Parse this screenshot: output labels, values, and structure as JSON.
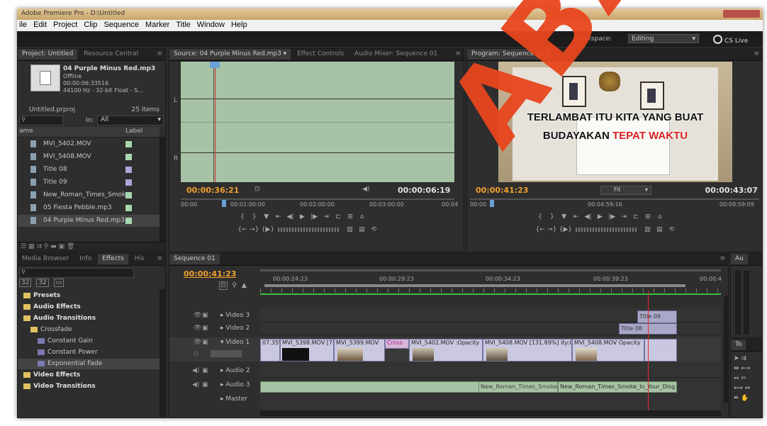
{
  "app": {
    "title": "Adobe Premiere Pro - D:\\Untitled"
  },
  "menu": [
    "ile",
    "Edit",
    "Project",
    "Clip",
    "Sequence",
    "Marker",
    "Title",
    "Window",
    "Help"
  ],
  "workspace": {
    "label": "Workspace:",
    "value": "Editing",
    "cs_live": "CS Live"
  },
  "project_panel": {
    "tabs": [
      "Project: Untitled",
      "Resource Central"
    ],
    "preview": {
      "name": "04 Purple Minus Red.mp3",
      "status": "Offline",
      "duration": "00:00:06:33516",
      "format": "44100 Hz - 32-bit Float - S..."
    },
    "project_file": "Untitled.prproj",
    "item_count": "25 Items",
    "in_label": "In:",
    "in_value": "All",
    "columns": {
      "name": "ame",
      "label": "Label"
    },
    "items": [
      {
        "name": "MVI_5402.MOV",
        "color": "#a8d8b0",
        "icon": "video-clip-icon"
      },
      {
        "name": "MVI_5408.MOV",
        "color": "#a8d8b0",
        "icon": "video-clip-icon"
      },
      {
        "name": "Title 08",
        "color": "#a9a8d8",
        "icon": "title-icon"
      },
      {
        "name": "Title 09",
        "color": "#a9a8d8",
        "icon": "title-icon"
      },
      {
        "name": "New_Roman_Times_Smok",
        "color": "#a8d8b0",
        "icon": "audio-clip-icon"
      },
      {
        "name": "05 Fiesta Pebble.mp3",
        "color": "#a8d8b0",
        "icon": "audio-file-icon"
      },
      {
        "name": "04 Purple Minus Red.mp3",
        "color": "#a8d8b0",
        "icon": "audio-file-icon"
      }
    ]
  },
  "effects_panel": {
    "tabs": [
      "Media Browser",
      "Info",
      "Effects",
      "His"
    ],
    "items": [
      {
        "label": "Presets",
        "level": 0
      },
      {
        "label": "Audio Effects",
        "level": 0
      },
      {
        "label": "Audio Transitions",
        "level": 0
      },
      {
        "label": "Crossfade",
        "level": 1
      },
      {
        "label": "Constant Gain",
        "level": 2
      },
      {
        "label": "Constant Power",
        "level": 2
      },
      {
        "label": "Exponential Fade",
        "level": 2
      },
      {
        "label": "Video Effects",
        "level": 0
      },
      {
        "label": "Video Transitions",
        "level": 0
      }
    ]
  },
  "source_monitor": {
    "tabs": [
      "Source: 04 Purple Minus Red.mp3",
      "Effect Controls",
      "Audio Mixer: Sequence 01"
    ],
    "channel_l": "L",
    "channel_r": "R",
    "timecode_current": "00:00:36:21",
    "timecode_duration": "00:00:06:19",
    "ruler": [
      "00:00",
      "00:01:00:00",
      "00:02:00:00",
      "00:03:00:00",
      "00:04"
    ]
  },
  "program_monitor": {
    "tabs": [
      "Program: Sequence 01"
    ],
    "overlay_line1": "TERLAMBAT ITU KITA YANG BUAT",
    "overlay_line2a": "BUDAYAKAN ",
    "overlay_line2b": "TEPAT WAKTU",
    "timecode_current": "00:00:41:23",
    "fit": "Fit",
    "timecode_duration": "00:00:43:07",
    "ruler": [
      "00:00",
      "00:04:59:16",
      "00:09:59:09"
    ]
  },
  "timeline": {
    "tab": "Sequence 01",
    "timecode": "00:00:41:23",
    "ruler": [
      "00:00:24:23",
      "00:00:29:23",
      "00:00:34:23",
      "00:00:39:23",
      "00:00:4"
    ],
    "tracks": [
      {
        "name": "Video 3"
      },
      {
        "name": "Video 2"
      },
      {
        "name": "Video 1"
      },
      {
        "name": "Audio 2"
      },
      {
        "name": "Audio 3"
      },
      {
        "name": "Master"
      }
    ],
    "video3_clip": "Title 09",
    "video2_clip": "Title 08",
    "video1_clips": [
      "07.35%]",
      "MVI_5398.MOV [7:",
      "MVI_5399.MOV",
      "Cross",
      "MVI_5402.MOV",
      ":Opacity",
      "MVI_5408.MOV [131.89%]",
      "ity:Opacity",
      "MVI_5408.MOV",
      "Opacity"
    ],
    "audio3_clips": [
      "New_Roman_Times_Smoke",
      "New_Roman_Times_Smoke_In_Your_Disg"
    ]
  },
  "tools_panel": {
    "tab": "To"
  },
  "audio_meter": {
    "tab": "Au"
  },
  "watermark": "ABAYA",
  "colors": {
    "accent_orange": "#f0a030",
    "watermark": "#e8461e",
    "audio_clip": "#a7c2a4",
    "video_clip": "#c9c8e0"
  }
}
